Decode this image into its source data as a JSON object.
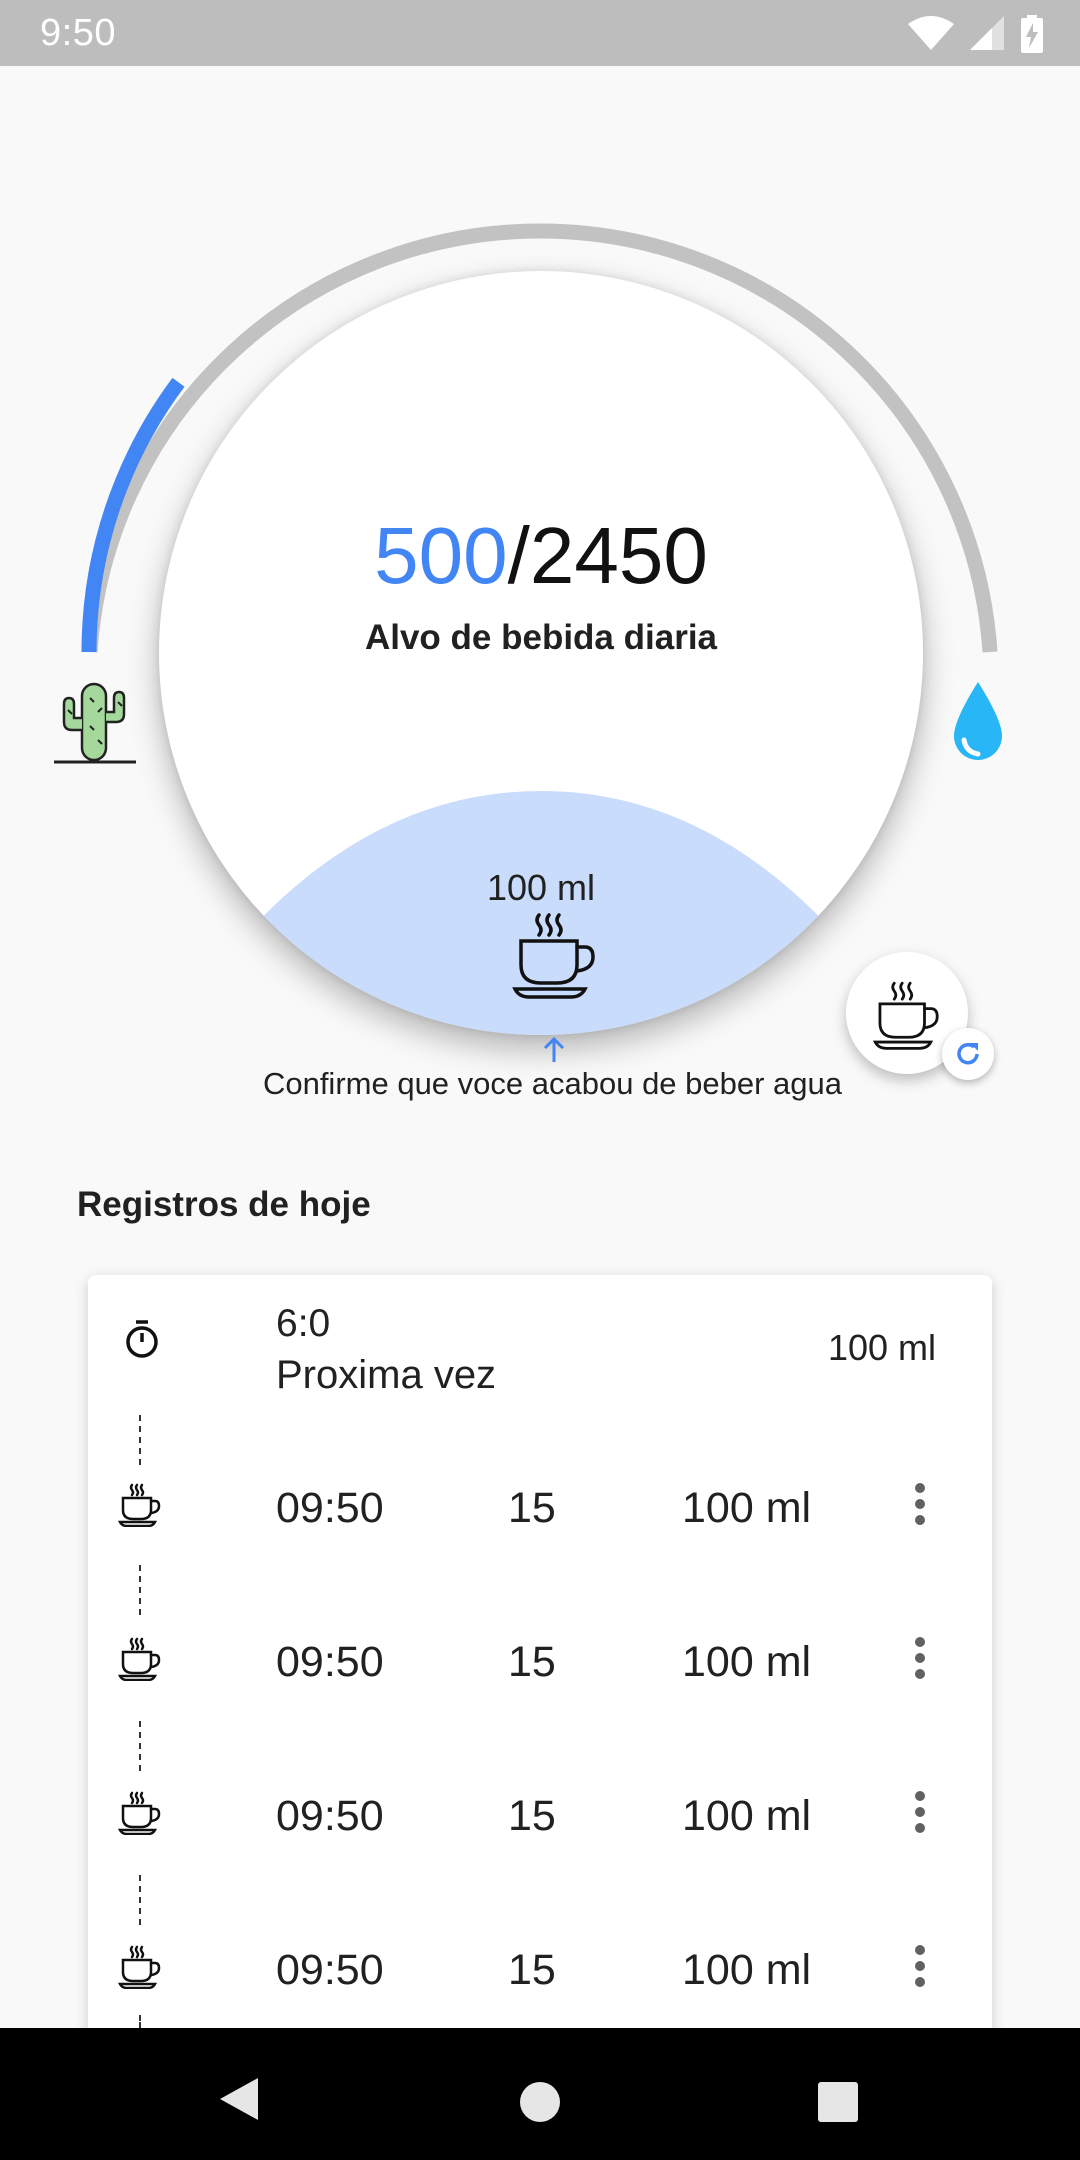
{
  "status_bar": {
    "time": "9:50",
    "icons": [
      "wifi-icon",
      "cellular-signal-icon",
      "battery-charging-icon"
    ]
  },
  "progress": {
    "current": "500",
    "separator": "/",
    "target": "2450",
    "label": "Alvo de bebida diaria",
    "fraction": 0.204
  },
  "cup": {
    "amount": "100 ml",
    "icon": "coffee-cup-icon"
  },
  "confirm_text": "Confirme que voce acabou de beber agua",
  "section_title": "Registros de hoje",
  "next": {
    "time": "6:0",
    "label": "Proxima vez",
    "amount": "100 ml"
  },
  "records": [
    {
      "time": "09:50",
      "value": "15",
      "amount": "100 ml"
    },
    {
      "time": "09:50",
      "value": "15",
      "amount": "100 ml"
    },
    {
      "time": "09:50",
      "value": "15",
      "amount": "100 ml"
    },
    {
      "time": "09:50",
      "value": "15",
      "amount": "100 ml"
    }
  ],
  "colors": {
    "accent": "#4285f4",
    "track": "#c2c2c2",
    "wave": "#c9dcfb",
    "cactus": "#a5d99c",
    "drop": "#29b6f6"
  }
}
